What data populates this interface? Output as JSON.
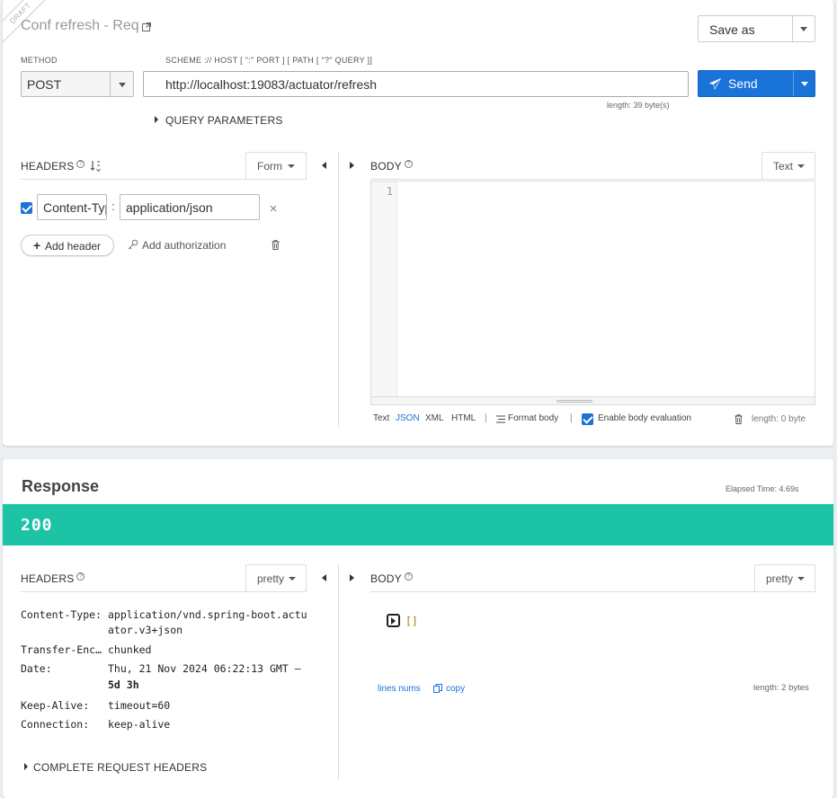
{
  "request": {
    "ribbon": "DRAFT",
    "title": "Conf refresh - Req",
    "save_as_label": "Save as",
    "method_label": "METHOD",
    "method_value": "POST",
    "url_label": "SCHEME :// HOST [ \":\" PORT ] [ PATH [ \"?\" QUERY ]]",
    "url_value": "http://localhost:19083/actuator/refresh",
    "url_length": "length: 39 byte(s)",
    "send_label": "Send",
    "query_params_label": "QUERY PARAMETERS",
    "headers": {
      "title": "HEADERS",
      "help": "?",
      "mode": "Form",
      "rows": [
        {
          "checked": true,
          "name": "Content-Type",
          "separator": ":",
          "value": "application/json"
        }
      ],
      "add_header_label": "Add header",
      "add_auth_label": "Add authorization"
    },
    "body": {
      "title": "BODY",
      "help": "?",
      "mode": "Text",
      "line_number": "1",
      "formats": [
        "Text",
        "JSON",
        "XML",
        "HTML"
      ],
      "active_format": "JSON",
      "divider": "|",
      "format_body_label": "Format body",
      "enable_eval_label": "Enable body evaluation",
      "length": "length: 0 byte"
    }
  },
  "response": {
    "title": "Response",
    "elapsed": "Elapsed Time: 4.69s",
    "status_code": "200",
    "status_color": "#1cc3a5",
    "headers": {
      "title": "HEADERS",
      "help": "?",
      "mode": "pretty",
      "items": [
        {
          "key": "Content-Type:",
          "value": "application/vnd.spring-boot.actuator.v3+json"
        },
        {
          "key": "Transfer-Enc…",
          "value": "chunked"
        },
        {
          "key": "Date:",
          "value": "Thu, 21 Nov 2024 06:22:13 GMT –",
          "extra": "5d 3h"
        },
        {
          "key": "Keep-Alive:",
          "value": "timeout=60"
        },
        {
          "key": "Connection:",
          "value": "keep-alive"
        }
      ],
      "complete_label": "COMPLETE REQUEST HEADERS"
    },
    "body": {
      "title": "BODY",
      "help": "?",
      "mode": "pretty",
      "content": "[]",
      "lines_nums_label": "lines nums",
      "copy_label": "copy",
      "length": "length: 2 bytes"
    }
  },
  "colors": {
    "accent": "#1a73d8",
    "success": "#1cc3a5"
  }
}
